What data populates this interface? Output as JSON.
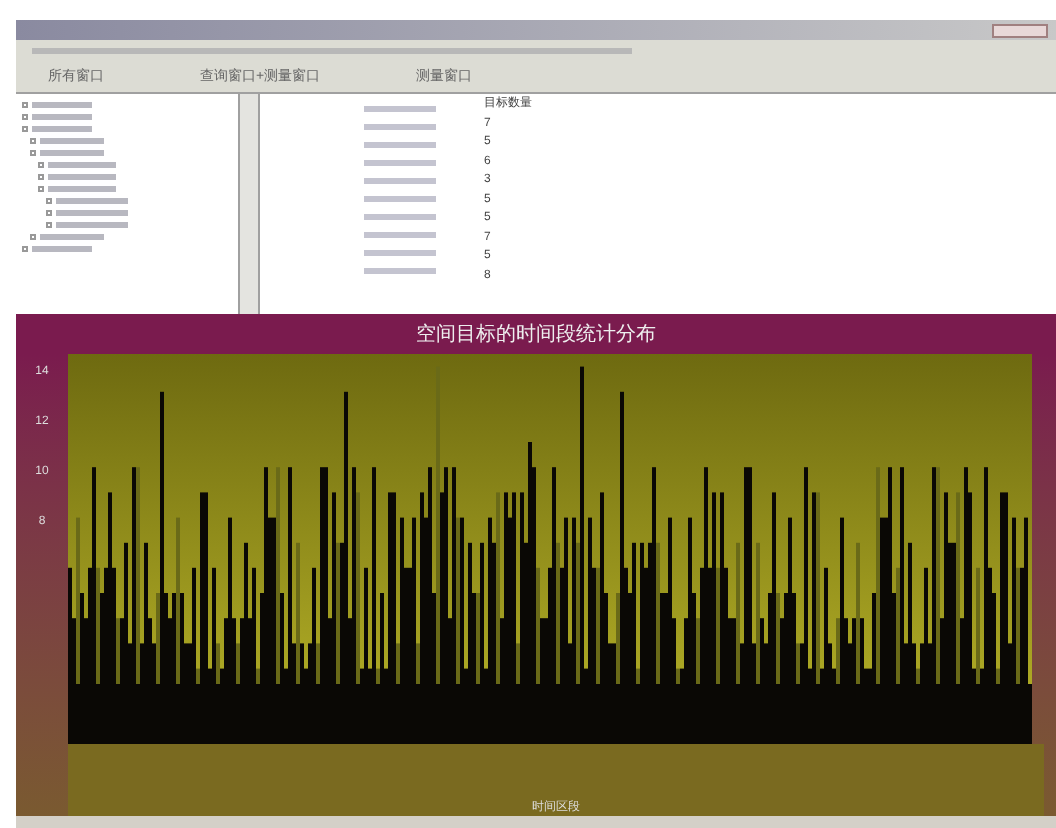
{
  "toolbar": [
    {
      "label": "所有窗口"
    },
    {
      "label": "查询窗口+测量窗口"
    },
    {
      "label": "测量窗口"
    }
  ],
  "table": {
    "columns": [
      "目标数量"
    ],
    "rows": [
      "7",
      "5",
      "6",
      "3",
      "5",
      "5",
      "7",
      "5",
      "8"
    ]
  },
  "chart": {
    "title": "空间目标的时间段统计分布",
    "yticks": [
      "14",
      "12",
      "10",
      "8"
    ],
    "xlabel": "时间区段"
  }
}
